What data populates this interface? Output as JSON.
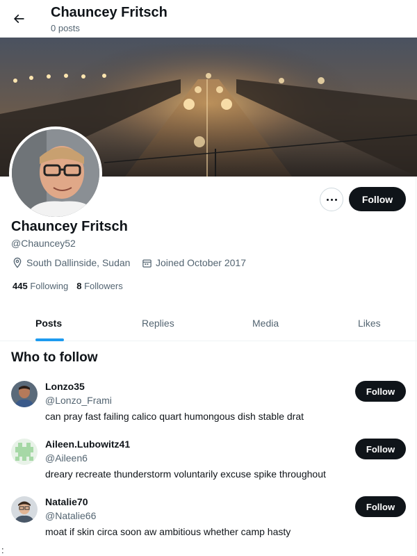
{
  "header": {
    "title": "Chauncey Fritsch",
    "posts_count": "0 posts",
    "back_icon": "arrow-left-icon"
  },
  "profile": {
    "name": "Chauncey Fritsch",
    "handle": "@Chauncey52",
    "location": "South Dallinside, Sudan",
    "joined": "Joined October 2017",
    "following_count": "445",
    "following_label": "Following",
    "followers_count": "8",
    "followers_label": "Followers",
    "follow_label": "Follow"
  },
  "tabs": [
    {
      "label": "Posts",
      "active": true
    },
    {
      "label": "Replies",
      "active": false
    },
    {
      "label": "Media",
      "active": false
    },
    {
      "label": "Likes",
      "active": false
    }
  ],
  "who_to_follow": {
    "title": "Who to follow",
    "users": [
      {
        "name": "Lonzo35",
        "handle": "@Lonzo_Frami",
        "bio": "can pray fast failing calico quart humongous dish stable drat",
        "follow_label": "Follow"
      },
      {
        "name": "Aileen.Lubowitz41",
        "handle": "@Aileen6",
        "bio": "dreary recreate thunderstorm voluntarily excuse spike throughout",
        "follow_label": "Follow"
      },
      {
        "name": "Natalie70",
        "handle": "@Natalie66",
        "bio": "moat if skin circa soon aw ambitious whether camp hasty",
        "follow_label": "Follow"
      }
    ]
  },
  "stray_text": ":",
  "colors": {
    "accent": "#1d9bf0",
    "primary_button": "#0f1419",
    "secondary_text": "#536471"
  }
}
